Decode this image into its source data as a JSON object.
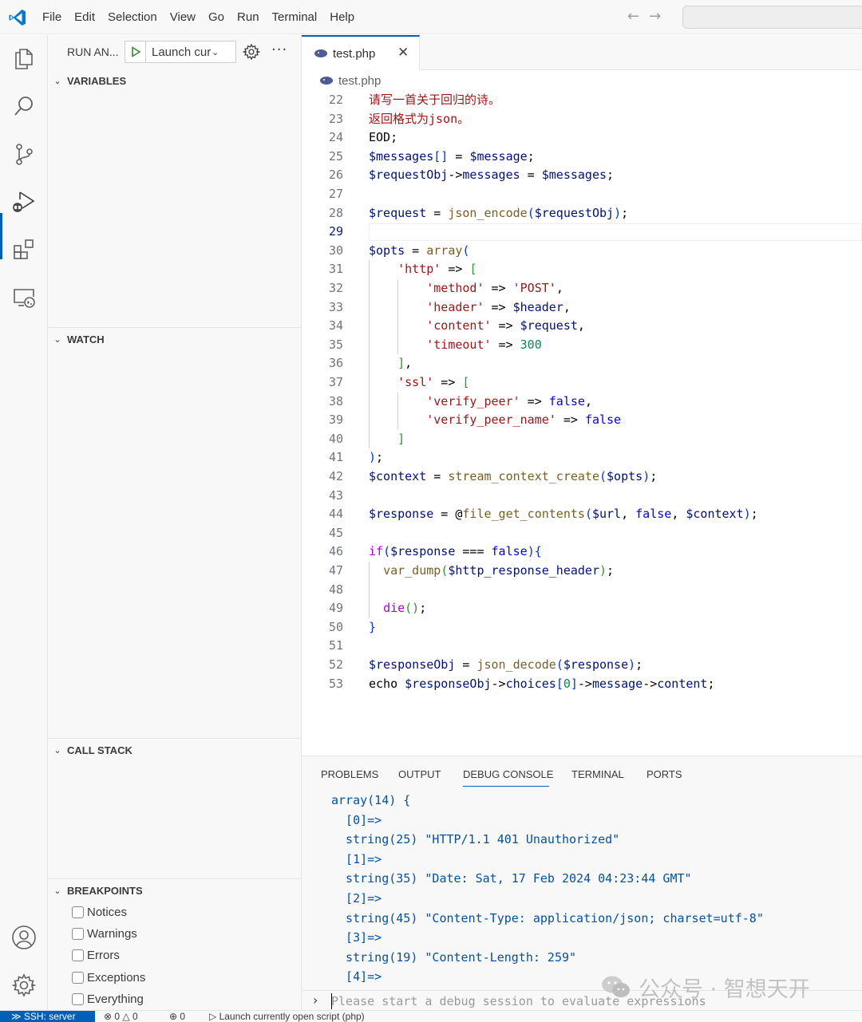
{
  "menu": [
    "File",
    "Edit",
    "Selection",
    "View",
    "Go",
    "Run",
    "Terminal",
    "Help"
  ],
  "sidebar": {
    "run_title": "RUN AN...",
    "launch_config": "Launch currently open script",
    "sections": {
      "variables": "VARIABLES",
      "watch": "WATCH",
      "call_stack": "CALL STACK",
      "breakpoints": "BREAKPOINTS"
    },
    "breakpoints": [
      "Notices",
      "Warnings",
      "Errors",
      "Exceptions",
      "Everything"
    ]
  },
  "editor": {
    "tab_label": "test.php",
    "breadcrumb": "test.php",
    "current_line": 29,
    "lines": [
      {
        "n": 22,
        "tokens": [
          [
            "str",
            "请写一首关于回归的诗。"
          ]
        ]
      },
      {
        "n": 23,
        "tokens": [
          [
            "str",
            "返回格式为json。"
          ]
        ]
      },
      {
        "n": 24,
        "tokens": [
          [
            "plain",
            "EOD;"
          ]
        ]
      },
      {
        "n": 25,
        "tokens": [
          [
            "var",
            "$messages"
          ],
          [
            "p1",
            "[]"
          ],
          [
            "plain",
            " = "
          ],
          [
            "var",
            "$message"
          ],
          [
            "plain",
            ";"
          ]
        ]
      },
      {
        "n": 26,
        "tokens": [
          [
            "var",
            "$requestObj"
          ],
          [
            "plain",
            "->"
          ],
          [
            "prop",
            "messages"
          ],
          [
            "plain",
            " = "
          ],
          [
            "var",
            "$messages"
          ],
          [
            "plain",
            ";"
          ]
        ]
      },
      {
        "n": 27,
        "tokens": []
      },
      {
        "n": 28,
        "tokens": [
          [
            "var",
            "$request"
          ],
          [
            "plain",
            " = "
          ],
          [
            "fn",
            "json_encode"
          ],
          [
            "p1",
            "("
          ],
          [
            "var",
            "$requestObj"
          ],
          [
            "p1",
            ")"
          ],
          [
            "plain",
            ";"
          ]
        ]
      },
      {
        "n": 29,
        "tokens": []
      },
      {
        "n": 30,
        "tokens": [
          [
            "var",
            "$opts"
          ],
          [
            "plain",
            " = "
          ],
          [
            "fn",
            "array"
          ],
          [
            "p1",
            "("
          ]
        ]
      },
      {
        "n": 31,
        "tokens": [
          [
            "plain",
            "    "
          ],
          [
            "str",
            "'http'"
          ],
          [
            "plain",
            " => "
          ],
          [
            "p2",
            "["
          ]
        ]
      },
      {
        "n": 32,
        "tokens": [
          [
            "plain",
            "        "
          ],
          [
            "str",
            "'method'"
          ],
          [
            "plain",
            " => "
          ],
          [
            "str",
            "'POST'"
          ],
          [
            "plain",
            ","
          ]
        ]
      },
      {
        "n": 33,
        "tokens": [
          [
            "plain",
            "        "
          ],
          [
            "str",
            "'header'"
          ],
          [
            "plain",
            " => "
          ],
          [
            "var",
            "$header"
          ],
          [
            "plain",
            ","
          ]
        ]
      },
      {
        "n": 34,
        "tokens": [
          [
            "plain",
            "        "
          ],
          [
            "str",
            "'content'"
          ],
          [
            "plain",
            " => "
          ],
          [
            "var",
            "$request"
          ],
          [
            "plain",
            ","
          ]
        ]
      },
      {
        "n": 35,
        "tokens": [
          [
            "plain",
            "        "
          ],
          [
            "str",
            "'timeout'"
          ],
          [
            "plain",
            " => "
          ],
          [
            "num",
            "300"
          ]
        ]
      },
      {
        "n": 36,
        "tokens": [
          [
            "plain",
            "    "
          ],
          [
            "p2",
            "]"
          ],
          [
            "plain",
            ","
          ]
        ]
      },
      {
        "n": 37,
        "tokens": [
          [
            "plain",
            "    "
          ],
          [
            "str",
            "'ssl'"
          ],
          [
            "plain",
            " => "
          ],
          [
            "p2",
            "["
          ]
        ]
      },
      {
        "n": 38,
        "tokens": [
          [
            "plain",
            "        "
          ],
          [
            "str",
            "'verify_peer'"
          ],
          [
            "plain",
            " => "
          ],
          [
            "kw",
            "false"
          ],
          [
            "plain",
            ","
          ]
        ]
      },
      {
        "n": 39,
        "tokens": [
          [
            "plain",
            "        "
          ],
          [
            "str",
            "'verify_peer_name'"
          ],
          [
            "plain",
            " => "
          ],
          [
            "kw",
            "false"
          ]
        ]
      },
      {
        "n": 40,
        "tokens": [
          [
            "plain",
            "    "
          ],
          [
            "p2",
            "]"
          ]
        ]
      },
      {
        "n": 41,
        "tokens": [
          [
            "p1",
            ")"
          ],
          [
            "plain",
            ";"
          ]
        ]
      },
      {
        "n": 42,
        "tokens": [
          [
            "var",
            "$context"
          ],
          [
            "plain",
            " = "
          ],
          [
            "fn",
            "stream_context_create"
          ],
          [
            "p1",
            "("
          ],
          [
            "var",
            "$opts"
          ],
          [
            "p1",
            ")"
          ],
          [
            "plain",
            ";"
          ]
        ]
      },
      {
        "n": 43,
        "tokens": []
      },
      {
        "n": 44,
        "tokens": [
          [
            "var",
            "$response"
          ],
          [
            "plain",
            " = @"
          ],
          [
            "fn",
            "file_get_contents"
          ],
          [
            "p1",
            "("
          ],
          [
            "var",
            "$url"
          ],
          [
            "plain",
            ", "
          ],
          [
            "kw",
            "false"
          ],
          [
            "plain",
            ", "
          ],
          [
            "var",
            "$context"
          ],
          [
            "p1",
            ")"
          ],
          [
            "plain",
            ";"
          ]
        ]
      },
      {
        "n": 45,
        "tokens": []
      },
      {
        "n": 46,
        "tokens": [
          [
            "ctl",
            "if"
          ],
          [
            "p1",
            "("
          ],
          [
            "var",
            "$response"
          ],
          [
            "plain",
            " === "
          ],
          [
            "kw",
            "false"
          ],
          [
            "p1",
            ")"
          ],
          [
            "p1",
            "{"
          ]
        ]
      },
      {
        "n": 47,
        "tokens": [
          [
            "plain",
            "  "
          ],
          [
            "fn",
            "var_dump"
          ],
          [
            "p2",
            "("
          ],
          [
            "var",
            "$http_response_header"
          ],
          [
            "p2",
            ")"
          ],
          [
            "plain",
            ";"
          ]
        ]
      },
      {
        "n": 48,
        "tokens": []
      },
      {
        "n": 49,
        "tokens": [
          [
            "plain",
            "  "
          ],
          [
            "ctl",
            "die"
          ],
          [
            "p2",
            "()"
          ],
          [
            "plain",
            ";"
          ]
        ]
      },
      {
        "n": 50,
        "tokens": [
          [
            "p1",
            "}"
          ]
        ]
      },
      {
        "n": 51,
        "tokens": []
      },
      {
        "n": 52,
        "tokens": [
          [
            "var",
            "$responseObj"
          ],
          [
            "plain",
            " = "
          ],
          [
            "fn",
            "json_decode"
          ],
          [
            "p1",
            "("
          ],
          [
            "var",
            "$response"
          ],
          [
            "p1",
            ")"
          ],
          [
            "plain",
            ";"
          ]
        ]
      },
      {
        "n": 53,
        "tokens": [
          [
            "plain",
            "echo "
          ],
          [
            "var",
            "$responseObj"
          ],
          [
            "plain",
            "->"
          ],
          [
            "prop",
            "choices"
          ],
          [
            "p1",
            "["
          ],
          [
            "num",
            "0"
          ],
          [
            "p1",
            "]"
          ],
          [
            "plain",
            "->"
          ],
          [
            "prop",
            "message"
          ],
          [
            "plain",
            "->"
          ],
          [
            "prop",
            "content"
          ],
          [
            "plain",
            ";"
          ]
        ]
      }
    ]
  },
  "panel": {
    "tabs": [
      "PROBLEMS",
      "OUTPUT",
      "DEBUG CONSOLE",
      "TERMINAL",
      "PORTS"
    ],
    "active_tab": "DEBUG CONSOLE",
    "console_lines": [
      "array(14) {",
      "  [0]=>",
      "  string(25) \"HTTP/1.1 401 Unauthorized\"",
      "  [1]=>",
      "  string(35) \"Date: Sat, 17 Feb 2024 04:23:44 GMT\"",
      "  [2]=>",
      "  string(45) \"Content-Type: application/json; charset=utf-8\"",
      "  [3]=>",
      "  string(19) \"Content-Length: 259\"",
      "  [4]=>"
    ],
    "console_placeholder": "Please start a debug session to evaluate expressions"
  },
  "watermark": "公众号 · 智想天开",
  "statusbar": {
    "remote": "SSH: server",
    "errors": "0",
    "warnings": "0",
    "ports": "0",
    "launch": "Launch currently open script (php)"
  },
  "colors": {
    "accent": "#005fb8",
    "string": "#a31515",
    "variable": "#001080",
    "function": "#795e26",
    "keyword": "#0000ff"
  }
}
